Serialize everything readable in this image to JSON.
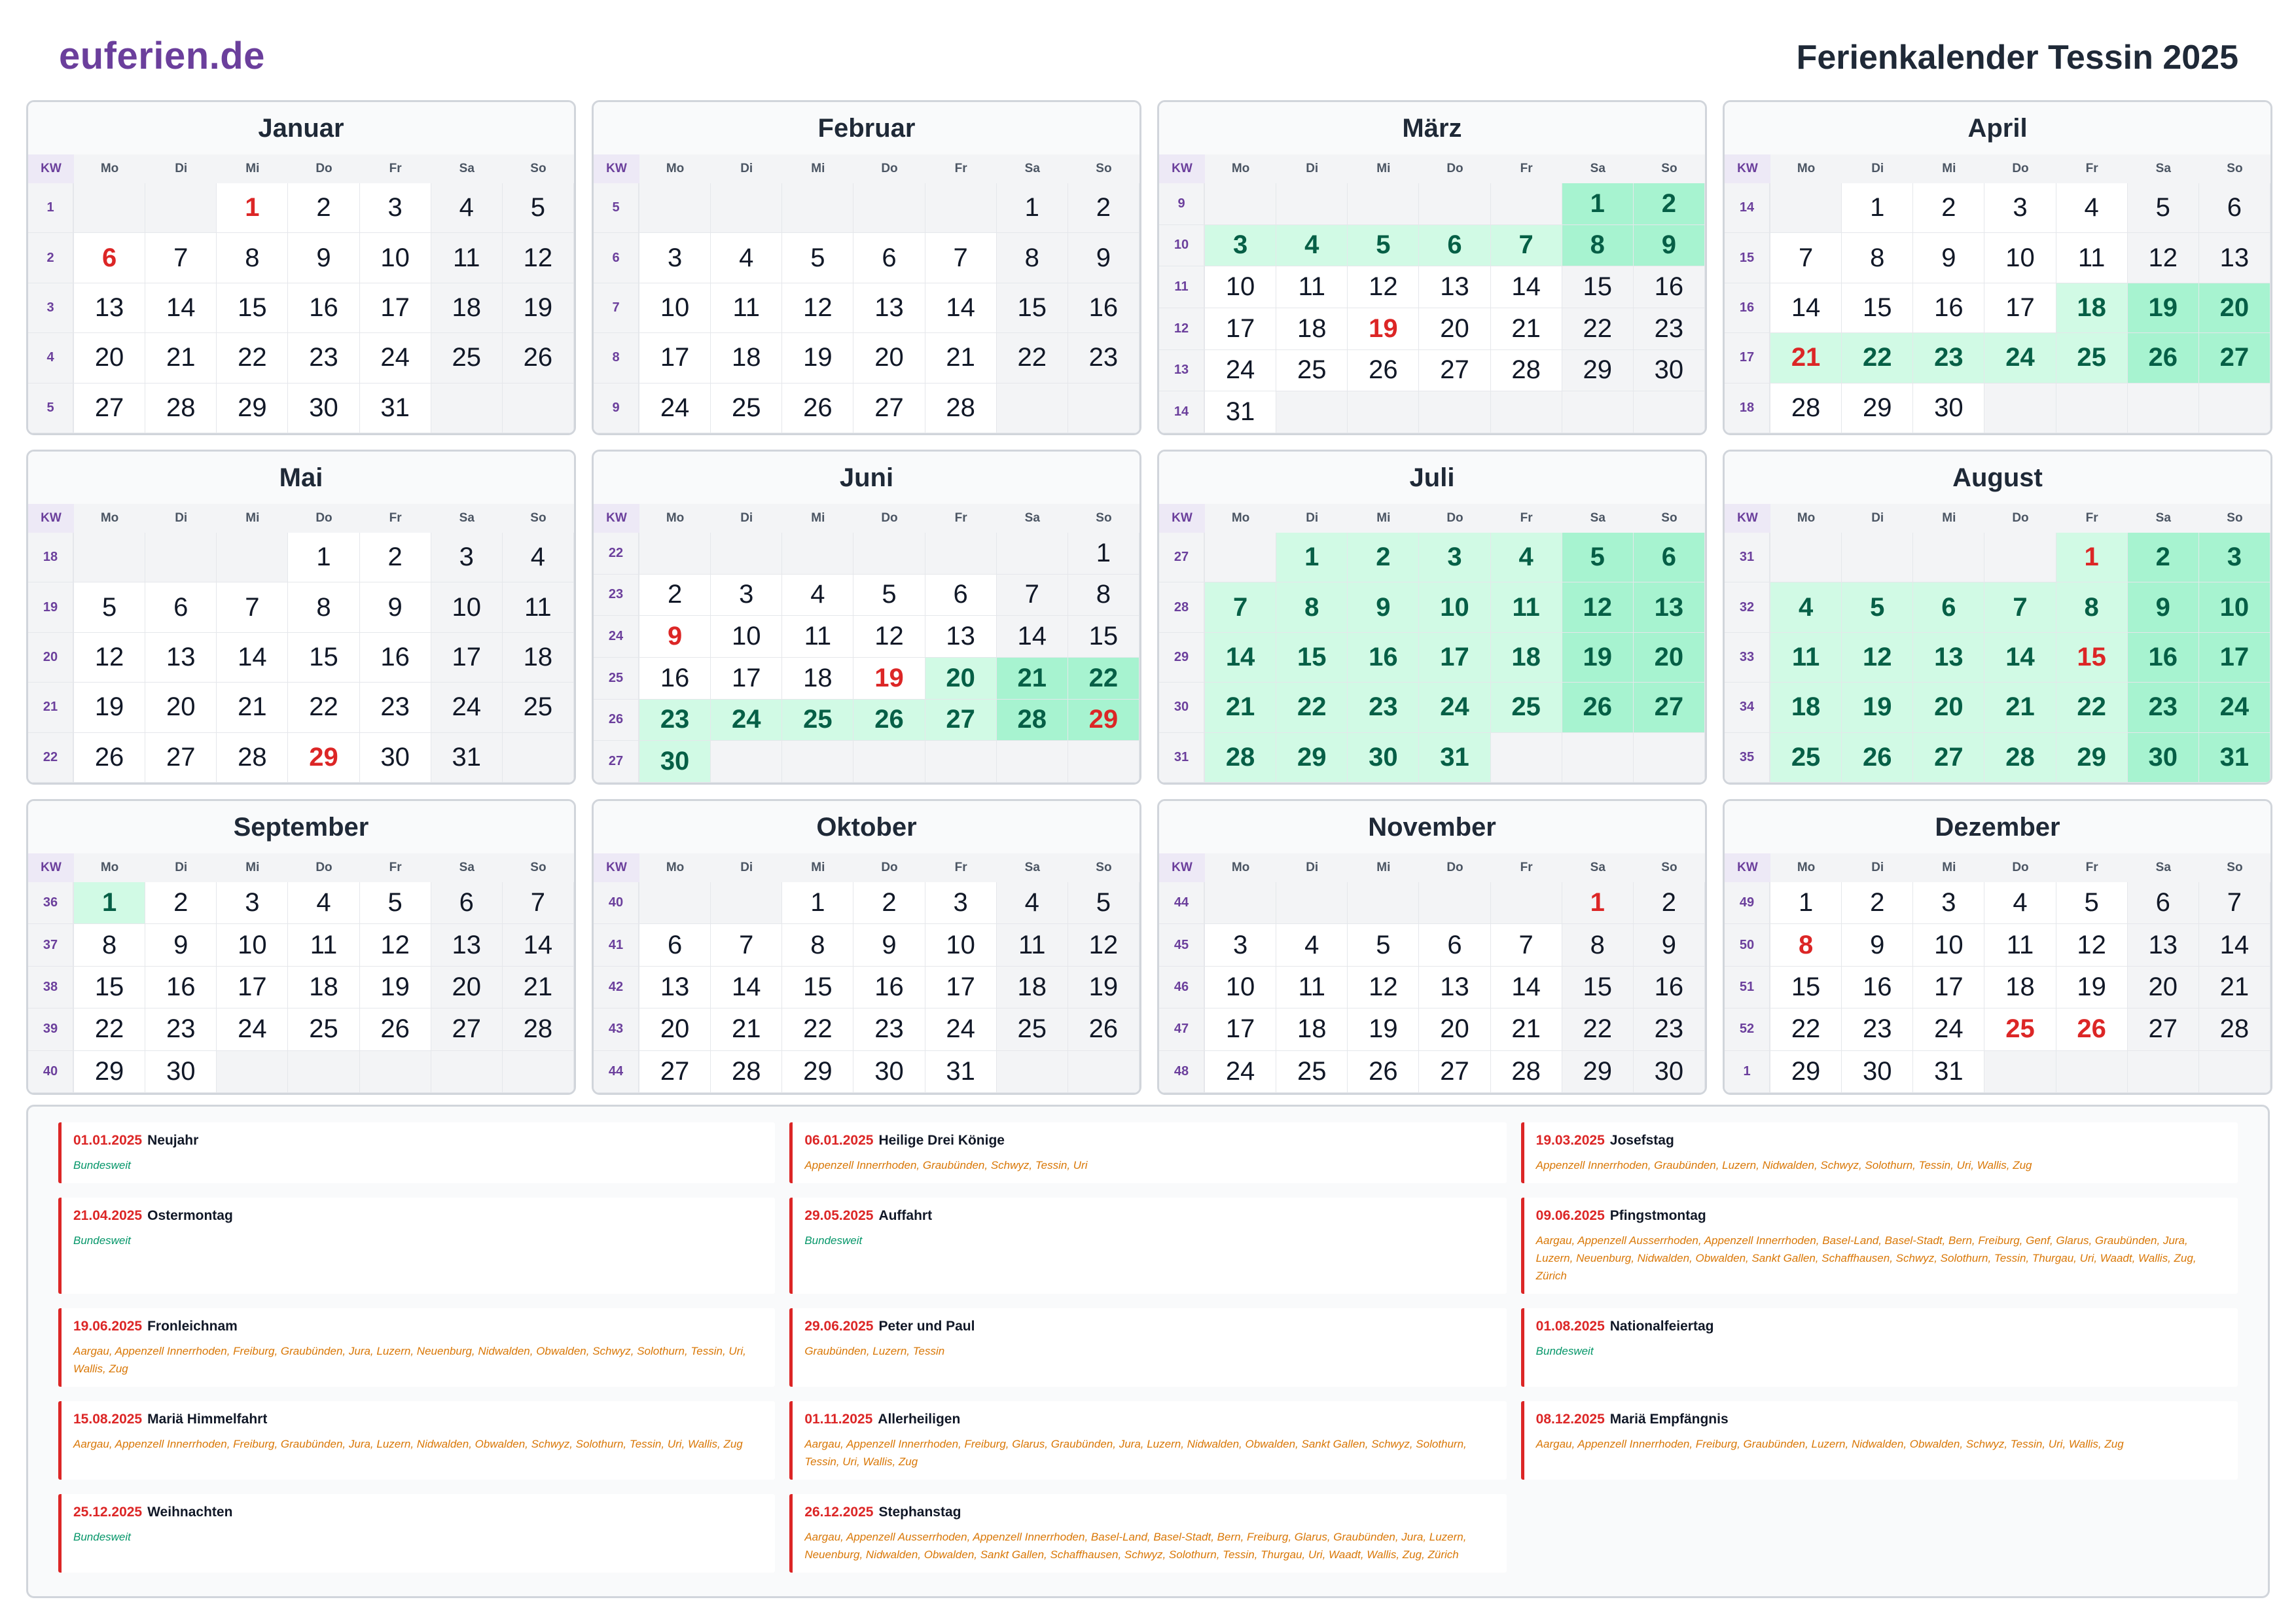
{
  "header": {
    "logo": "euferien.de",
    "title": "Ferienkalender Tessin 2025"
  },
  "weekday_header": [
    "KW",
    "Mo",
    "Di",
    "Mi",
    "Do",
    "Fr",
    "Sa",
    "So"
  ],
  "months": [
    {
      "name": "Januar",
      "first": 2,
      "days": 31,
      "kws": [
        1,
        2,
        3,
        4,
        5
      ],
      "holidays": [
        1,
        6
      ],
      "vacation": []
    },
    {
      "name": "Februar",
      "first": 5,
      "days": 28,
      "kws": [
        5,
        6,
        7,
        8,
        9
      ],
      "holidays": [],
      "vacation": []
    },
    {
      "name": "März",
      "first": 5,
      "days": 31,
      "kws": [
        9,
        10,
        11,
        12,
        13,
        14
      ],
      "holidays": [
        19
      ],
      "vacation": [
        1,
        2,
        3,
        4,
        5,
        6,
        7,
        8,
        9
      ]
    },
    {
      "name": "April",
      "first": 1,
      "days": 30,
      "kws": [
        14,
        15,
        16,
        17,
        18
      ],
      "holidays": [
        21
      ],
      "vacation": [
        18,
        19,
        20,
        21,
        22,
        23,
        24,
        25,
        26,
        27
      ]
    },
    {
      "name": "Mai",
      "first": 3,
      "days": 31,
      "kws": [
        18,
        19,
        20,
        21,
        22
      ],
      "holidays": [
        29
      ],
      "vacation": []
    },
    {
      "name": "Juni",
      "first": 6,
      "days": 30,
      "kws": [
        22,
        23,
        24,
        25,
        26,
        27
      ],
      "holidays": [
        9,
        19,
        29
      ],
      "vacation": [
        20,
        21,
        22,
        23,
        24,
        25,
        26,
        27,
        28,
        29,
        30
      ]
    },
    {
      "name": "Juli",
      "first": 1,
      "days": 31,
      "kws": [
        27,
        28,
        29,
        30,
        31
      ],
      "holidays": [],
      "vacation": [
        1,
        2,
        3,
        4,
        5,
        6,
        7,
        8,
        9,
        10,
        11,
        12,
        13,
        14,
        15,
        16,
        17,
        18,
        19,
        20,
        21,
        22,
        23,
        24,
        25,
        26,
        27,
        28,
        29,
        30,
        31
      ]
    },
    {
      "name": "August",
      "first": 4,
      "days": 31,
      "kws": [
        31,
        32,
        33,
        34,
        35
      ],
      "holidays": [
        1,
        15
      ],
      "vacation": [
        1,
        2,
        3,
        4,
        5,
        6,
        7,
        8,
        9,
        10,
        11,
        12,
        13,
        14,
        15,
        16,
        17,
        18,
        19,
        20,
        21,
        22,
        23,
        24,
        25,
        26,
        27,
        28,
        29,
        30,
        31
      ]
    },
    {
      "name": "September",
      "first": 0,
      "days": 30,
      "kws": [
        36,
        37,
        38,
        39,
        40
      ],
      "holidays": [],
      "vacation": [
        1
      ]
    },
    {
      "name": "Oktober",
      "first": 2,
      "days": 31,
      "kws": [
        40,
        41,
        42,
        43,
        44
      ],
      "holidays": [],
      "vacation": []
    },
    {
      "name": "November",
      "first": 5,
      "days": 30,
      "kws": [
        44,
        45,
        46,
        47,
        48
      ],
      "holidays": [
        1
      ],
      "vacation": []
    },
    {
      "name": "Dezember",
      "first": 0,
      "days": 31,
      "kws": [
        49,
        50,
        51,
        52,
        1
      ],
      "holidays": [
        8,
        25,
        26
      ],
      "vacation": []
    }
  ],
  "holidays": [
    {
      "date": "01.01.2025",
      "name": "Neujahr",
      "regions": "Bundesweit",
      "all": true
    },
    {
      "date": "06.01.2025",
      "name": "Heilige Drei Könige",
      "regions": "Appenzell Innerrhoden, Graubünden, Schwyz, Tessin, Uri",
      "all": false
    },
    {
      "date": "19.03.2025",
      "name": "Josefstag",
      "regions": "Appenzell Innerrhoden, Graubünden, Luzern, Nidwalden, Schwyz, Solothurn, Tessin, Uri, Wallis, Zug",
      "all": false
    },
    {
      "date": "21.04.2025",
      "name": "Ostermontag",
      "regions": "Bundesweit",
      "all": true
    },
    {
      "date": "29.05.2025",
      "name": "Auffahrt",
      "regions": "Bundesweit",
      "all": true
    },
    {
      "date": "09.06.2025",
      "name": "Pfingstmontag",
      "regions": "Aargau, Appenzell Ausserrhoden, Appenzell Innerrhoden, Basel-Land, Basel-Stadt, Bern, Freiburg, Genf, Glarus, Graubünden, Jura, Luzern, Neuenburg, Nidwalden, Obwalden, Sankt Gallen, Schaffhausen, Schwyz, Solothurn, Tessin, Thurgau, Uri, Waadt, Wallis, Zug, Zürich",
      "all": false
    },
    {
      "date": "19.06.2025",
      "name": "Fronleichnam",
      "regions": "Aargau, Appenzell Innerrhoden, Freiburg, Graubünden, Jura, Luzern, Neuenburg, Nidwalden, Obwalden, Schwyz, Solothurn, Tessin, Uri, Wallis, Zug",
      "all": false
    },
    {
      "date": "29.06.2025",
      "name": "Peter und Paul",
      "regions": "Graubünden, Luzern, Tessin",
      "all": false
    },
    {
      "date": "01.08.2025",
      "name": "Nationalfeiertag",
      "regions": "Bundesweit",
      "all": true
    },
    {
      "date": "15.08.2025",
      "name": "Mariä Himmelfahrt",
      "regions": "Aargau, Appenzell Innerrhoden, Freiburg, Graubünden, Jura, Luzern, Nidwalden, Obwalden, Schwyz, Solothurn, Tessin, Uri, Wallis, Zug",
      "all": false
    },
    {
      "date": "01.11.2025",
      "name": "Allerheiligen",
      "regions": "Aargau, Appenzell Innerrhoden, Freiburg, Glarus, Graubünden, Jura, Luzern, Nidwalden, Obwalden, Sankt Gallen, Schwyz, Solothurn, Tessin, Uri, Wallis, Zug",
      "all": false
    },
    {
      "date": "08.12.2025",
      "name": "Mariä Empfängnis",
      "regions": "Aargau, Appenzell Innerrhoden, Freiburg, Graubünden, Luzern, Nidwalden, Obwalden, Schwyz, Tessin, Uri, Wallis, Zug",
      "all": false
    },
    {
      "date": "25.12.2025",
      "name": "Weihnachten",
      "regions": "Bundesweit",
      "all": true
    },
    {
      "date": "26.12.2025",
      "name": "Stephanstag",
      "regions": "Aargau, Appenzell Ausserrhoden, Appenzell Innerrhoden, Basel-Land, Basel-Stadt, Bern, Freiburg, Glarus, Graubünden, Jura, Luzern, Neuenburg, Nidwalden, Obwalden, Sankt Gallen, Schaffhausen, Schwyz, Solothurn, Tessin, Thurgau, Uri, Waadt, Wallis, Zug, Zürich",
      "all": false
    }
  ]
}
